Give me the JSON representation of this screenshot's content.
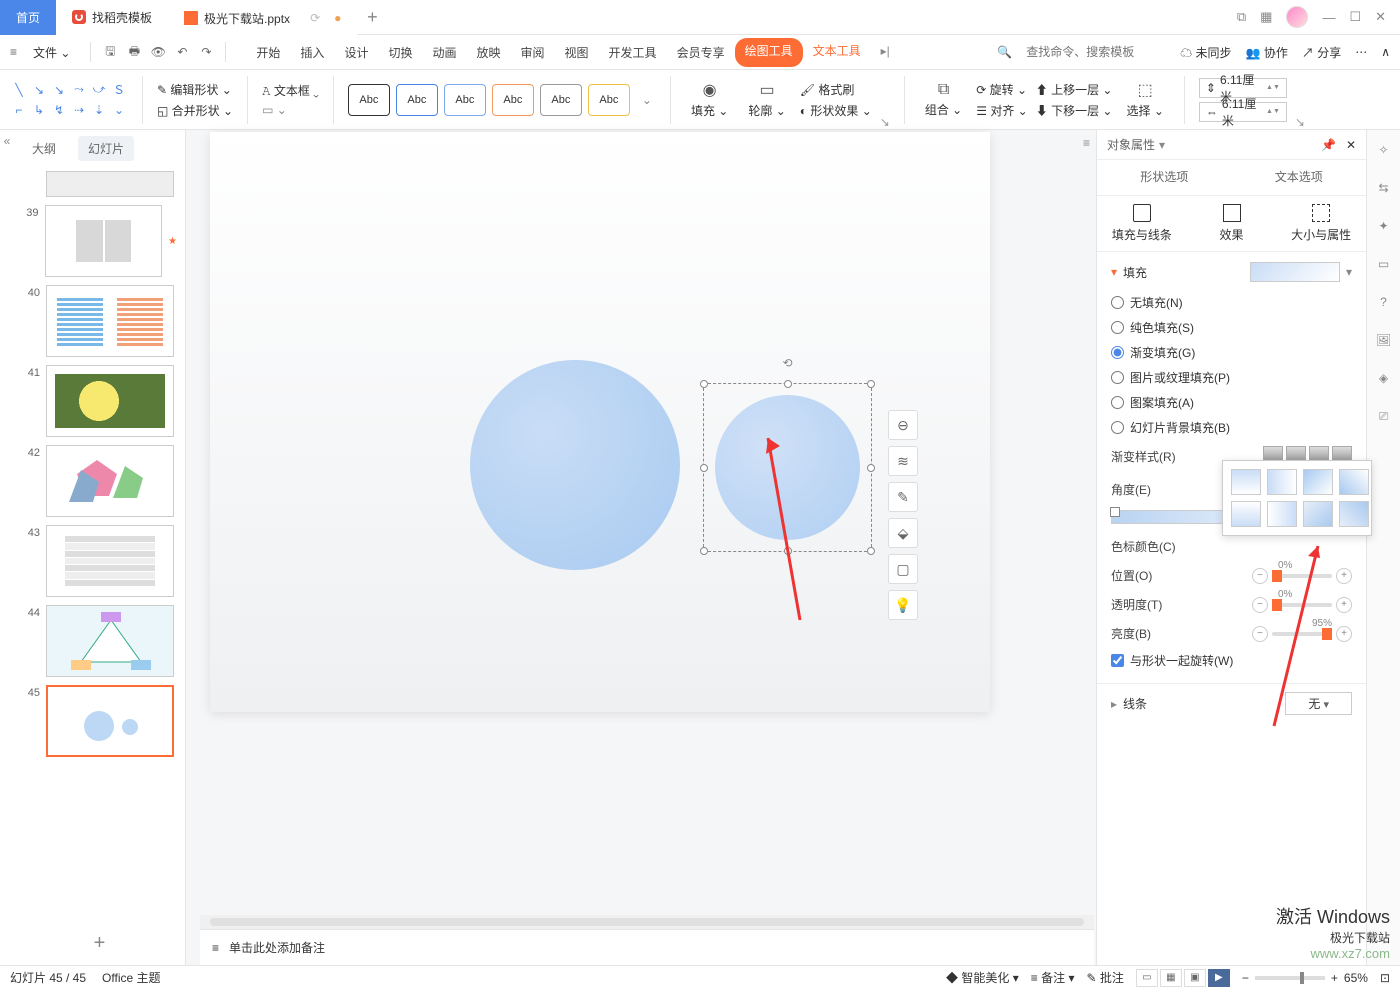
{
  "titlebar": {
    "tabs": [
      {
        "label": "首页"
      },
      {
        "label": "找稻壳模板"
      },
      {
        "label": "极光下载站.pptx"
      }
    ]
  },
  "menu": {
    "file": "文件",
    "items": [
      "开始",
      "插入",
      "设计",
      "切换",
      "动画",
      "放映",
      "审阅",
      "视图",
      "开发工具",
      "会员专享"
    ],
    "drawing": "绘图工具",
    "textTool": "文本工具",
    "search_ph": "查找命令、搜索模板",
    "unsynced": "未同步",
    "coop": "协作",
    "share": "分享"
  },
  "ribbon": {
    "editShape": "编辑形状",
    "mergeShape": "合并形状",
    "textbox": "文本框",
    "abc": "Abc",
    "fill": "填充",
    "outline": "轮廓",
    "formatPainter": "格式刷",
    "shapeFx": "形状效果",
    "group": "组合",
    "rotate": "旋转",
    "align": "对齐",
    "bringFwd": "上移一层",
    "sendBack": "下移一层",
    "select": "选择",
    "width": "6.11厘米",
    "height": "6.11厘米"
  },
  "leftPanel": {
    "outline": "大纲",
    "slides": "幻灯片",
    "nums": [
      "",
      "39",
      "40",
      "41",
      "42",
      "43",
      "44",
      "45"
    ]
  },
  "notes_ph": "单击此处添加备注",
  "rpanel": {
    "title": "对象属性",
    "tabs": {
      "shape": "形状选项",
      "text": "文本选项"
    },
    "sub": {
      "fillLine": "填充与线条",
      "effect": "效果",
      "sizeProp": "大小与属性"
    },
    "fill": "填充",
    "opts": {
      "none": "无填充(N)",
      "solid": "纯色填充(S)",
      "gradient": "渐变填充(G)",
      "picture": "图片或纹理填充(P)",
      "pattern": "图案填充(A)",
      "slidebg": "幻灯片背景填充(B)"
    },
    "gradStyle": "渐变样式(R)",
    "angle": "角度(E)",
    "stopColor": "色标颜色(C)",
    "position": "位置(O)",
    "posVal": "0%",
    "transparency": "透明度(T)",
    "transVal": "0%",
    "brightness": "亮度(B)",
    "brightVal": "95%",
    "rotateWith": "与形状一起旋转(W)",
    "line": "线条",
    "lineVal": "无"
  },
  "status": {
    "slide": "幻灯片 45 / 45",
    "theme": "Office 主题",
    "beautify": "智能美化",
    "notes": "备注",
    "comments": "批注",
    "zoom": "65%"
  },
  "watermark": {
    "w1": "激活 Windows",
    "w2": "极光下载站",
    "w3": "www.xz7.com"
  }
}
